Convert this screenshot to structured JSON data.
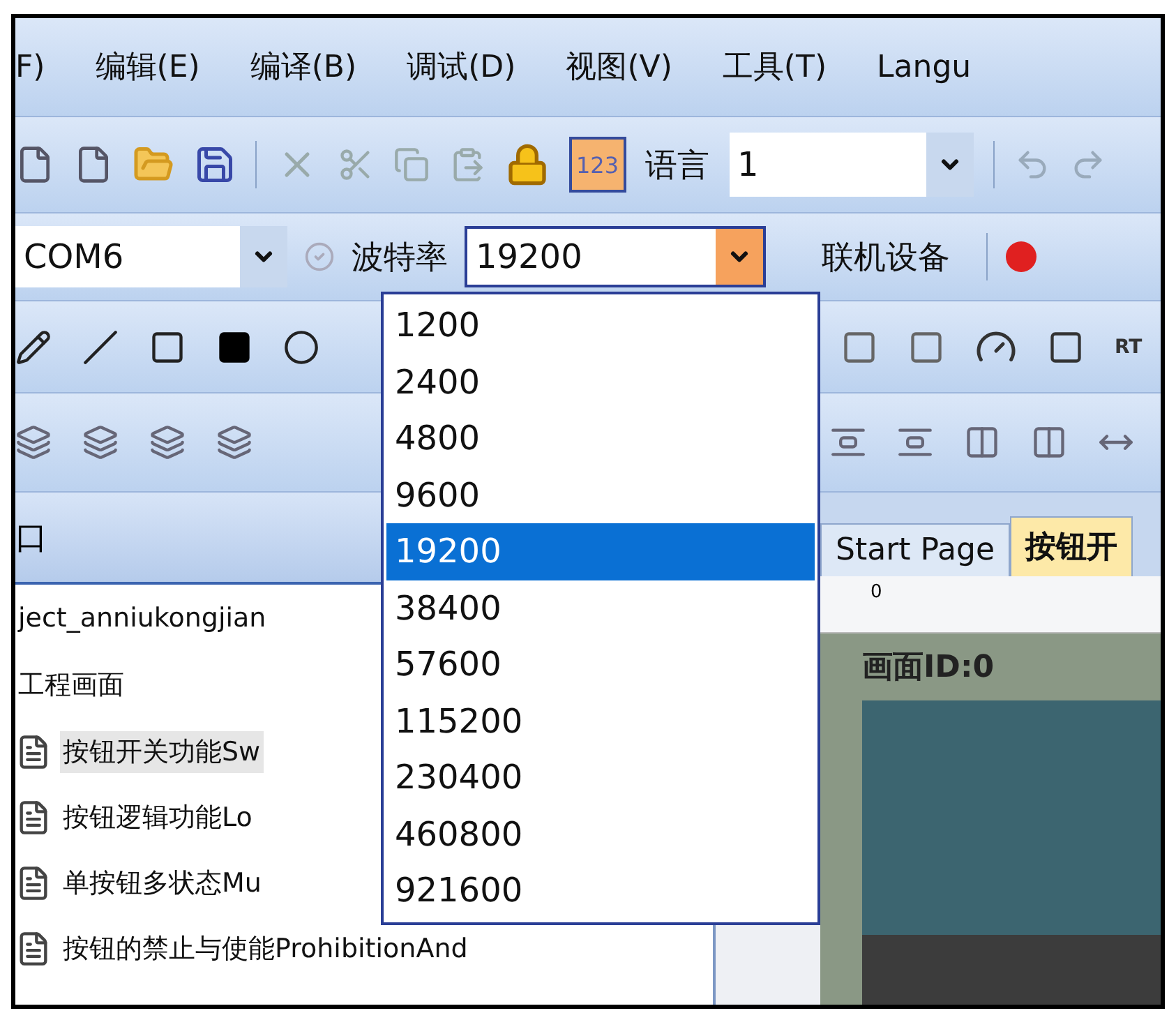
{
  "menu": [
    {
      "label": "F)"
    },
    {
      "label": "编辑(E)"
    },
    {
      "label": "编译(B)"
    },
    {
      "label": "调试(D)"
    },
    {
      "label": "视图(V)"
    },
    {
      "label": "工具(T)"
    },
    {
      "label": "Langu"
    }
  ],
  "toolbar": {
    "number_button": "123",
    "language_label": "语言",
    "language_value": "1"
  },
  "connection_bar": {
    "port": "COM6",
    "baud_label": "波特率",
    "baud_value": "19200",
    "connect_button": "联机设备"
  },
  "drawing_toolbar": {
    "text_tool": "RT"
  },
  "baud_options": [
    {
      "label": "1200",
      "selected": false
    },
    {
      "label": "2400",
      "selected": false
    },
    {
      "label": "4800",
      "selected": false
    },
    {
      "label": "9600",
      "selected": false
    },
    {
      "label": "19200",
      "selected": true
    },
    {
      "label": "38400",
      "selected": false
    },
    {
      "label": "57600",
      "selected": false
    },
    {
      "label": "115200",
      "selected": false
    },
    {
      "label": "230400",
      "selected": false
    },
    {
      "label": "460800",
      "selected": false
    },
    {
      "label": "921600",
      "selected": false
    }
  ],
  "project_panel": {
    "title": "口",
    "tree": [
      {
        "label": "ject_anniukongjian",
        "children": [
          {
            "label": "工程画面",
            "children": [
              {
                "label": "按钮开关功能Sw",
                "selected": true
              },
              {
                "label": "按钮逻辑功能Lo",
                "selected": false
              },
              {
                "label": "单按钮多状态Mu",
                "selected": false
              },
              {
                "label": "按钮的禁止与使能ProhibitionAnd",
                "selected": false
              }
            ]
          }
        ]
      }
    ]
  },
  "tabs": [
    {
      "label": "Start Page",
      "selected": false
    },
    {
      "label": "按钮开",
      "selected": true
    }
  ],
  "ruler": {
    "start": "0"
  },
  "canvas": {
    "title": "画面ID:0"
  }
}
